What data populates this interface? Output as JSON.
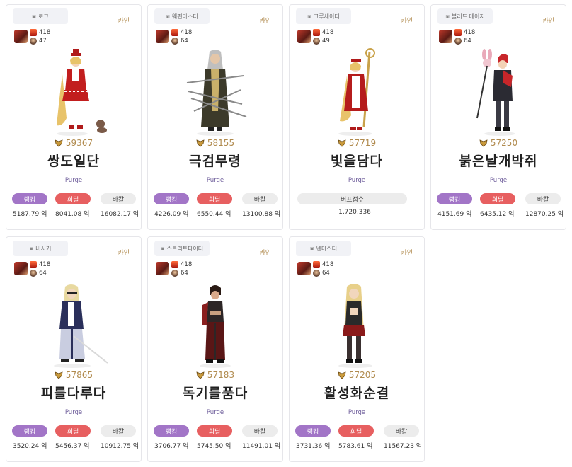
{
  "cards": [
    {
      "job": "로그",
      "server": "카인",
      "level": "418",
      "fame": "47",
      "power": "59367",
      "name": "쌍도일단",
      "guild": "Purge",
      "tags": {
        "rank": "랭킹",
        "heal": "회딜",
        "bakal": "바칼"
      },
      "values": {
        "rank": "5187.79 억",
        "heal": "8041.08 억",
        "bakal": "16082.17 억"
      }
    },
    {
      "job": "웨펀마스터",
      "server": "카인",
      "level": "418",
      "fame": "64",
      "power": "58155",
      "name": "극검무령",
      "guild": "Purge",
      "tags": {
        "rank": "랭킹",
        "heal": "회딜",
        "bakal": "바칼"
      },
      "values": {
        "rank": "4226.09 억",
        "heal": "6550.44 억",
        "bakal": "13100.88 억"
      }
    },
    {
      "job": "크루세이더",
      "server": "카인",
      "level": "418",
      "fame": "49",
      "power": "57719",
      "name": "빛을담다",
      "guild": "Purge",
      "buff_label": "버프점수",
      "buff_value": "1,720,336"
    },
    {
      "job": "블러드 메이지",
      "server": "카인",
      "level": "418",
      "fame": "64",
      "power": "57250",
      "name": "붉은날개박쥐",
      "guild": "Purge",
      "tags": {
        "rank": "랭킹",
        "heal": "회딜",
        "bakal": "바칼"
      },
      "values": {
        "rank": "4151.69 억",
        "heal": "6435.12 억",
        "bakal": "12870.25 억"
      }
    },
    {
      "job": "버서커",
      "server": "카인",
      "level": "418",
      "fame": "64",
      "power": "57865",
      "name": "피를다루다",
      "guild": "Purge",
      "tags": {
        "rank": "랭킹",
        "heal": "회딜",
        "bakal": "바칼"
      },
      "values": {
        "rank": "3520.24 억",
        "heal": "5456.37 억",
        "bakal": "10912.75 억"
      }
    },
    {
      "job": "스트리트파이터",
      "server": "카인",
      "level": "418",
      "fame": "64",
      "power": "57183",
      "name": "독기를품다",
      "guild": "Purge",
      "tags": {
        "rank": "랭킹",
        "heal": "회딜",
        "bakal": "바칼"
      },
      "values": {
        "rank": "3706.77 억",
        "heal": "5745.50 억",
        "bakal": "11491.01 억"
      }
    },
    {
      "job": "넨마스터",
      "server": "카인",
      "level": "418",
      "fame": "64",
      "power": "57205",
      "name": "활성화순결",
      "guild": "Purge",
      "tags": {
        "rank": "랭킹",
        "heal": "회딜",
        "bakal": "바칼"
      },
      "values": {
        "rank": "3731.36 억",
        "heal": "5783.61 억",
        "bakal": "11567.23 억"
      }
    }
  ],
  "colors": {
    "rank": "#a275c7",
    "heal": "#e75f60",
    "bakal": "#ececec",
    "power": "#b08a4d",
    "guild": "#6d5c9a"
  }
}
